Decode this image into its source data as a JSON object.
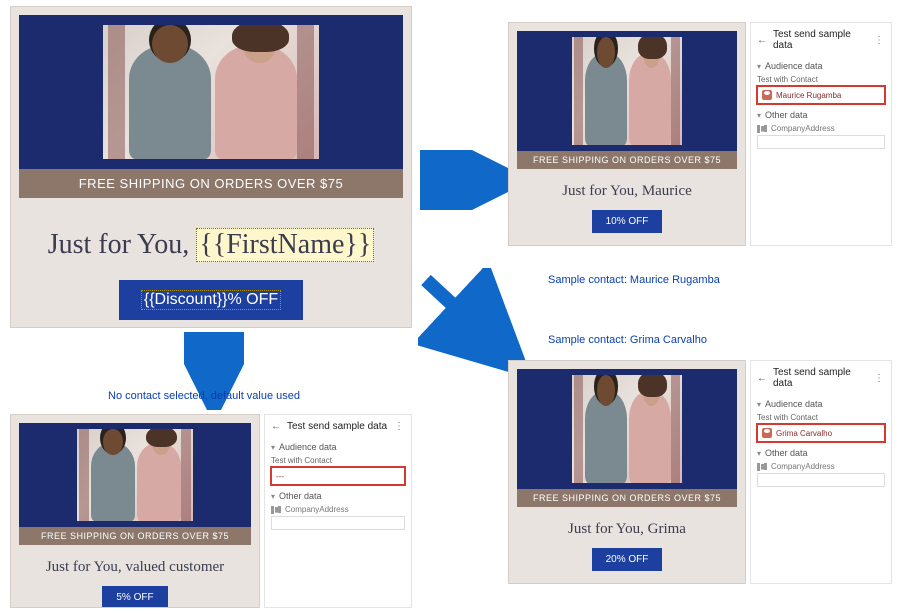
{
  "shipping_banner": "FREE SHIPPING ON ORDERS OVER $75",
  "headline_prefix": "Just for You, ",
  "template": {
    "firstname_token": "{{FirstName}}",
    "discount_token": "{{Discount}}% OFF"
  },
  "side_panel": {
    "title": "Test send sample data",
    "audience_section": "Audience data",
    "contact_label": "Test with Contact",
    "other_section": "Other data",
    "company_label": "CompanyAddress"
  },
  "scenarios": {
    "default": {
      "resolved_name": "valued customer",
      "discount_label": "5% OFF",
      "contact_value": "---"
    },
    "maurice": {
      "resolved_name": "Maurice",
      "discount_label": "10% OFF",
      "contact_value": "Maurice Rugamba"
    },
    "grima": {
      "resolved_name": "Grima",
      "discount_label": "20% OFF",
      "contact_value": "Grima Carvalho"
    }
  },
  "annotations": {
    "down": "No contact selected, default value used",
    "right_top": "Sample contact: Maurice Rugamba",
    "right_bottom": "Sample contact: Grima Carvalho"
  }
}
